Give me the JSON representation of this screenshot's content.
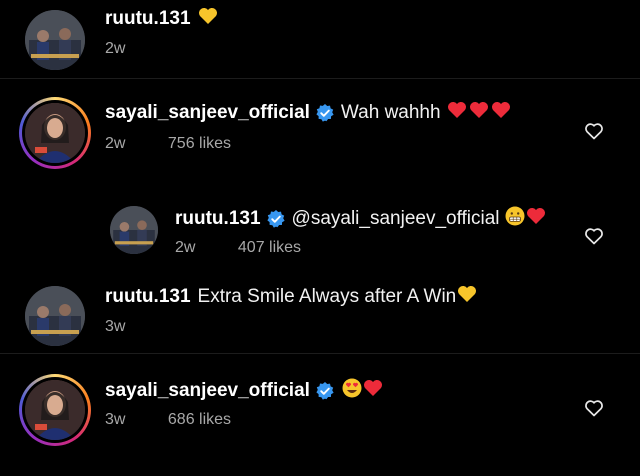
{
  "comments": [
    {
      "username": "ruutu.131",
      "verified": false,
      "text": "",
      "emoji": [
        "yellow-heart"
      ],
      "time": "2w",
      "likes": "",
      "story_ring": false,
      "reply": false
    },
    {
      "username": "sayali_sanjeev_official",
      "verified": true,
      "text": "Wah wahhh",
      "emoji": [
        "red-heart",
        "red-heart",
        "red-heart"
      ],
      "time": "2w",
      "likes": "756 likes",
      "story_ring": true,
      "reply": false
    },
    {
      "username": "ruutu.131",
      "verified": true,
      "text": "@sayali_sanjeev_official",
      "emoji": [
        "grimacing-face",
        "red-heart"
      ],
      "time": "2w",
      "likes": "407 likes",
      "story_ring": false,
      "reply": true
    },
    {
      "username": "ruutu.131",
      "verified": false,
      "text": "Extra Smile Always after A Win",
      "emoji": [
        "yellow-heart"
      ],
      "time": "3w",
      "likes": "",
      "story_ring": false,
      "reply": false
    },
    {
      "username": "sayali_sanjeev_official",
      "verified": true,
      "text": "",
      "emoji": [
        "heart-eyes-face",
        "red-heart"
      ],
      "time": "3w",
      "likes": "686 likes",
      "story_ring": true,
      "reply": false
    }
  ],
  "colors": {
    "background": "#000000",
    "verified": "#3897f0",
    "heart_red": "#ed2b3a",
    "heart_yellow": "#f7c52b",
    "meta": "#a8a8a8"
  }
}
